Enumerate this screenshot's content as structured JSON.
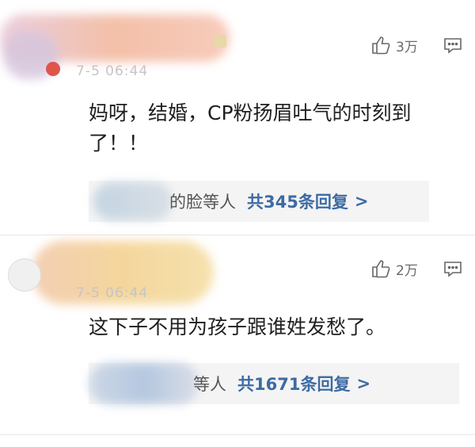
{
  "comments": [
    {
      "timestamp_partial": "7-5 06:44",
      "likes": "3万",
      "text": "妈呀，结婚，CP粉扬眉吐气的时刻到了！！",
      "reply_suffix": "的脸等人",
      "reply_count": "共345条回复",
      "reply_arrow": ">"
    },
    {
      "timestamp_partial": "7-5 06:44",
      "likes": "2万",
      "text": "这下子不用为孩子跟谁姓发愁了。",
      "reply_suffix": "等人",
      "reply_count": "共1671条回复",
      "reply_arrow": ">"
    }
  ],
  "icons": {
    "like": "thumbs-up-icon",
    "comment": "comment-icon"
  },
  "colors": {
    "link": "#3d6ba3",
    "reply_bg": "#f4f4f4",
    "timestamp": "#c5c5c5"
  }
}
